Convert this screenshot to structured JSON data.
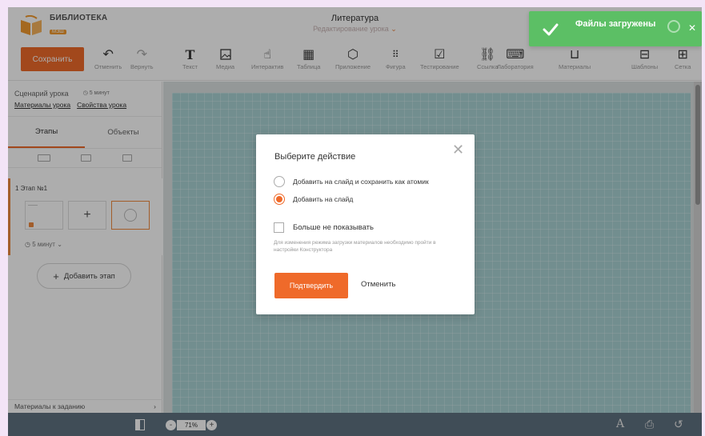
{
  "header": {
    "logo_title": "БИБЛИОТЕКА",
    "logo_sub": "МЭШ",
    "doc_title": "Литература",
    "doc_subtitle": "Редактирование урока"
  },
  "toolbar": {
    "save_label": "Сохранить",
    "tools": [
      {
        "label": "Отменить",
        "icon": "undo-icon"
      },
      {
        "label": "Вернуть",
        "icon": "redo-icon"
      },
      {
        "label": "Текст",
        "icon": "text-icon"
      },
      {
        "label": "Медиа",
        "icon": "media-icon"
      },
      {
        "label": "Интерактив",
        "icon": "interactive-icon"
      },
      {
        "label": "Таблица",
        "icon": "table-icon"
      },
      {
        "label": "Приложение",
        "icon": "app-icon"
      },
      {
        "label": "Фигура",
        "icon": "shape-icon"
      },
      {
        "label": "Тестирование",
        "icon": "test-icon"
      },
      {
        "label": "Ссылка",
        "icon": "link-icon"
      },
      {
        "label": "Лаборатория",
        "icon": "lab-icon"
      },
      {
        "label": "Материалы",
        "icon": "materials-icon"
      },
      {
        "label": "Шаблоны",
        "icon": "templates-icon"
      },
      {
        "label": "Сетка",
        "icon": "grid-icon"
      }
    ]
  },
  "toast": {
    "message": "Файлы загружены",
    "color": "#5cbf65"
  },
  "sidebar": {
    "scenario_label": "Сценарий урока",
    "time_label": "5 минут",
    "link_materials": "Материалы урока",
    "link_properties": "Свойства урока",
    "tab_stages": "Этапы",
    "tab_objects": "Объекты",
    "stage_title": "1  Этап №1",
    "stage_time": "5  минут",
    "add_stage_label": "Добавить этап",
    "footer_label": "Материалы к заданию"
  },
  "bottombar": {
    "zoom_value": "71%"
  },
  "modal": {
    "title": "Выберите действие",
    "option_1": "Добавить на слайд и сохранить как атомик",
    "option_2": "Добавить на слайд",
    "selected_option": 2,
    "checkbox_label": "Больше не показывать",
    "hint": "Для изменения режима загрузки материалов необходимо пройти в настройки Конструктора",
    "confirm_label": "Подтвердить",
    "cancel_label": "Отменить"
  },
  "colors": {
    "accent": "#ef6a2a",
    "canvas": "#a9d2d3",
    "bottombar": "#5f7281"
  }
}
